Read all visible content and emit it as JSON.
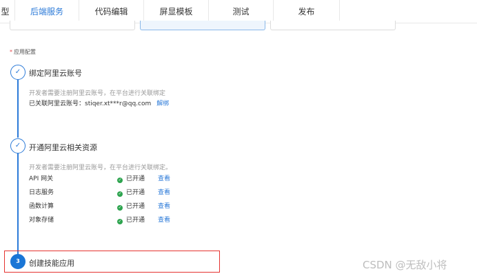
{
  "tabs": [
    {
      "label": "型",
      "active": false
    },
    {
      "label": "后端服务",
      "active": true
    },
    {
      "label": "代码编辑",
      "active": false
    },
    {
      "label": "屏显模板",
      "active": false
    },
    {
      "label": "测试",
      "active": false
    },
    {
      "label": "发布",
      "active": false
    }
  ],
  "section_label": "应用配置",
  "required_mark": "*",
  "steps": [
    {
      "number": "✓",
      "title": "绑定阿里云账号",
      "description": "开发者需要注册阿里云账号，在平台进行关联绑定",
      "bound_label": "已关联阿里云账号：stiqer.xt***r@qq.com",
      "unbind_label": "解绑"
    },
    {
      "number": "✓",
      "title": "开通阿里云相关资源",
      "description": "开发者需要注册阿里云账号，在平台进行关联绑定。",
      "services": [
        {
          "name": "API 网关",
          "status": "已开通",
          "action": "查看"
        },
        {
          "name": "日志服务",
          "status": "已开通",
          "action": "查看"
        },
        {
          "name": "函数计算",
          "status": "已开通",
          "action": "查看"
        },
        {
          "name": "对象存储",
          "status": "已开通",
          "action": "查看"
        }
      ]
    },
    {
      "number": "3",
      "title": "创建技能应用"
    }
  ],
  "status_icon": "check-circle-icon",
  "colors": {
    "accent": "#2b7ad8",
    "success": "#2ea44f",
    "highlight": "#e5312e"
  },
  "watermark": "CSDN @无敌小将"
}
